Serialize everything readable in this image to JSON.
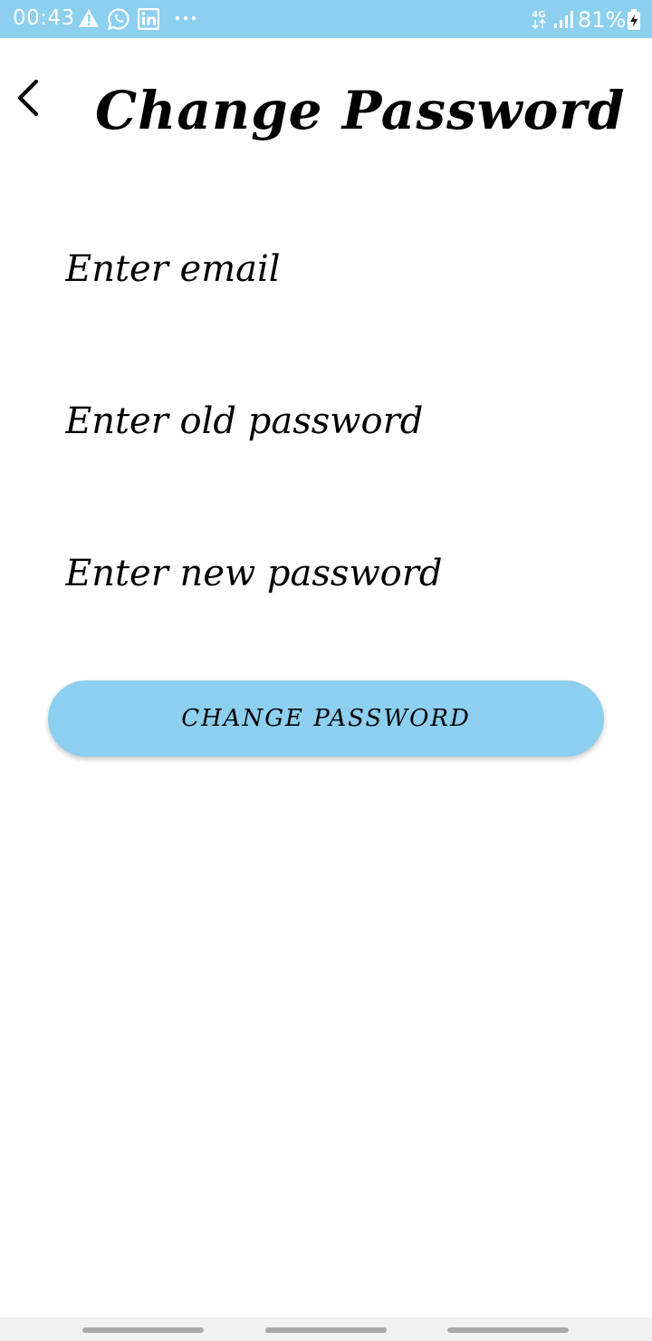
{
  "status_bar": {
    "time": "00:43",
    "network": "4G",
    "battery": "81%",
    "background": "#8ccfef",
    "icons": [
      "warning-icon",
      "whatsapp-icon",
      "linkedin-icon",
      "more-dots-icon",
      "network-arrows-icon",
      "signal-icon",
      "battery-charging-icon"
    ]
  },
  "header": {
    "title": "Change Password",
    "back_icon": "chevron-left-icon"
  },
  "form": {
    "email_placeholder": "Enter email",
    "old_password_placeholder": "Enter old password",
    "new_password_placeholder": "Enter new password",
    "submit_label": "CHANGE PASSWORD",
    "button_color": "#8ccfef"
  }
}
